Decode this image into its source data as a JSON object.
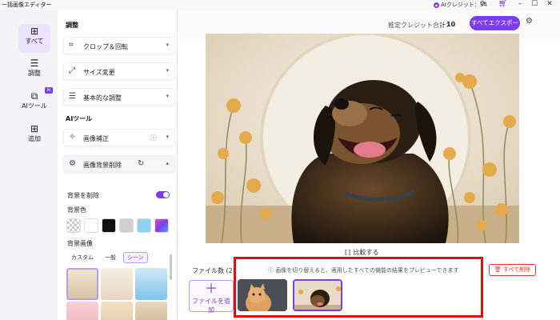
{
  "app": {
    "title": "一括画像エディター",
    "credit_label": "AIクレジット：34",
    "ai_icon": "ai-credit-icon"
  },
  "rail": {
    "items": [
      {
        "label": "すべて",
        "icon": "grid-icon"
      },
      {
        "label": "調整",
        "icon": "sliders-icon"
      },
      {
        "label": "AIツール",
        "icon": "ai-icon"
      },
      {
        "label": "追加",
        "icon": "plus-square-icon"
      }
    ],
    "ai_badge": "AI"
  },
  "panel": {
    "adjust_title": "調整",
    "crop": "クロップ＆回転",
    "resize": "サイズ変更",
    "basic": "基本的な調整",
    "ai_title": "AIツール",
    "enhance": "画像補正",
    "bg_remove": "画像背景削除",
    "remove_bg_label": "背景を削除",
    "remove_bg_on": true,
    "bg_color_label": "背景色",
    "bg_colors": [
      "transparent",
      "#ffffff",
      "#111111",
      "#cfcfcf",
      "#8fd0f5",
      "gradient"
    ],
    "bg_image_label": "背景画像",
    "tabs": [
      "カスタム",
      "一般",
      "シーン"
    ],
    "active_tab": "シーン"
  },
  "main": {
    "est_label": "推定クレジット合計：",
    "est_value": "10",
    "export_label": "すべてエクスポート",
    "compare_label": "比較する",
    "file_count": "ファイル数 (2)",
    "notice": "画像を切り替えると、適用したすべての機能の結果をプレビューできます",
    "delete_all": "すべて削除",
    "add_file": "ファイルを追加"
  },
  "colors": {
    "accent": "#7b3cf0",
    "danger": "#e01010"
  }
}
